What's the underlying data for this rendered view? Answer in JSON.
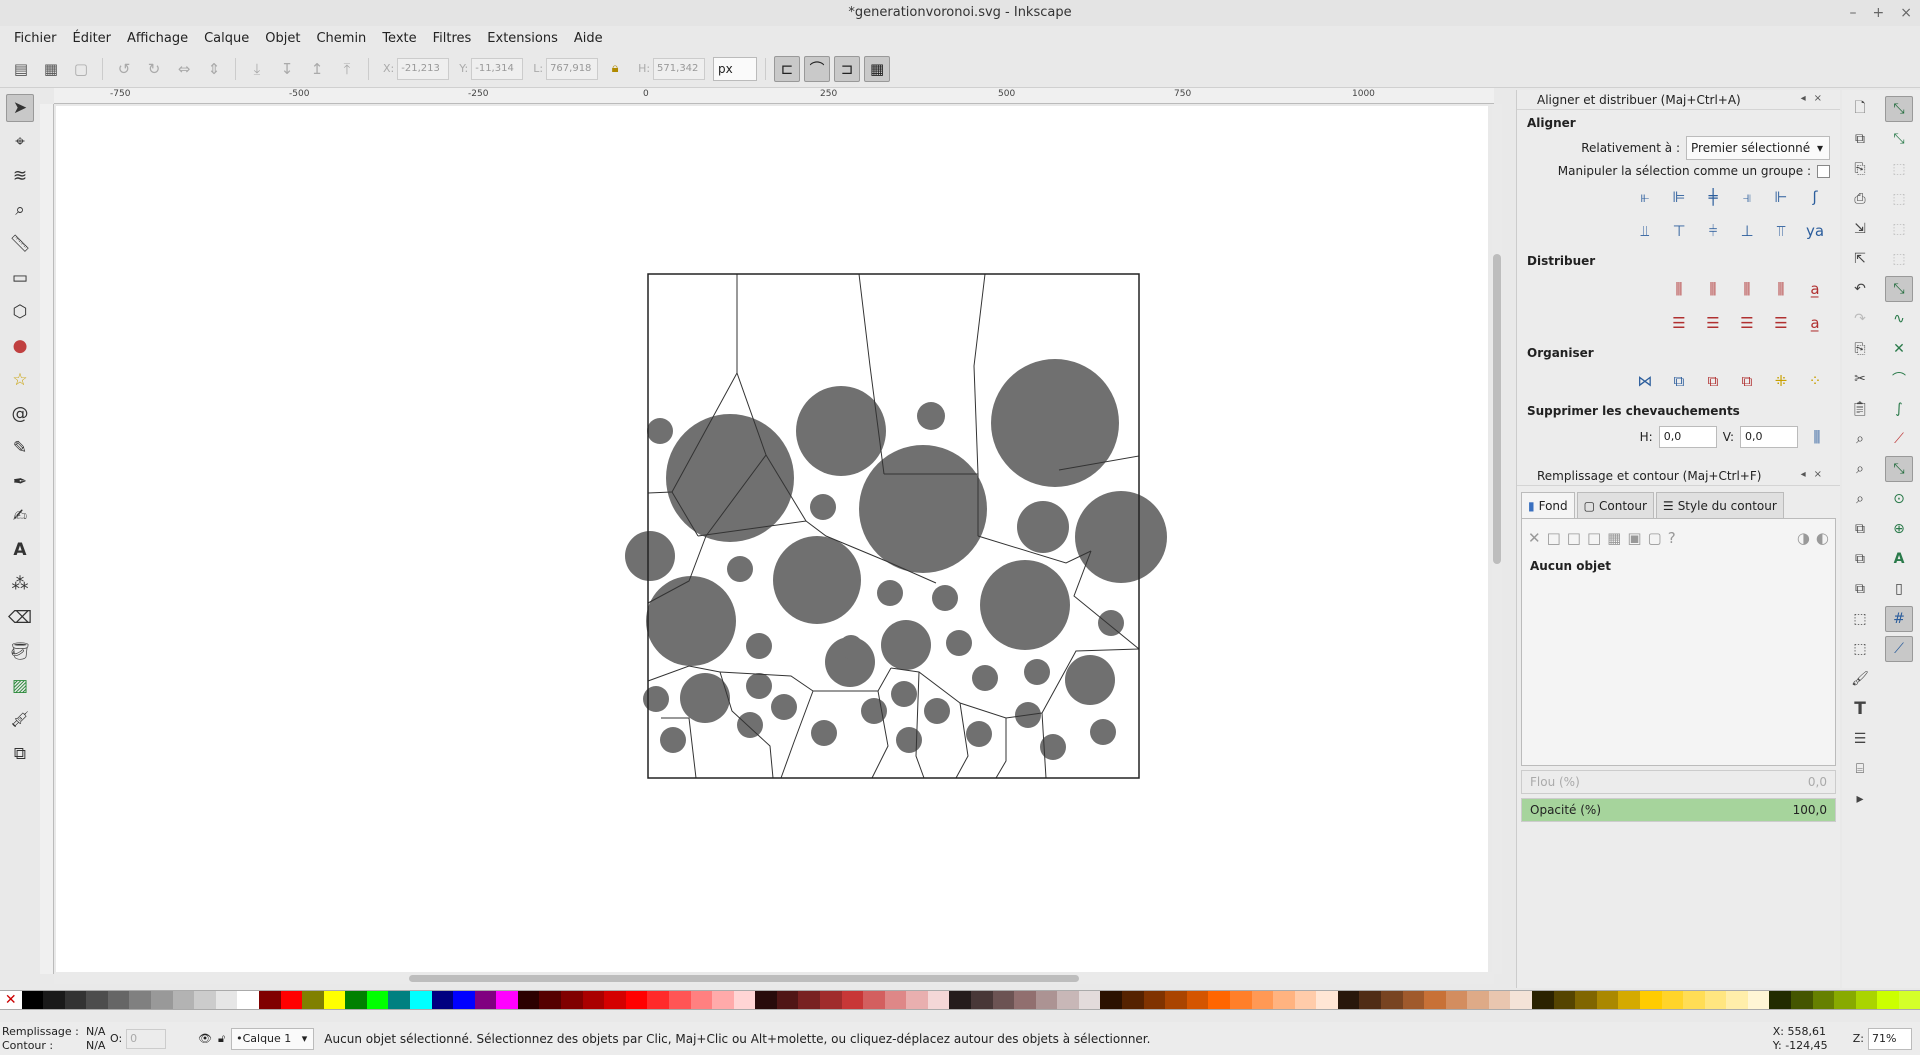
{
  "window": {
    "title": "*generationvoronoi.svg - Inkscape"
  },
  "menu": [
    "Fichier",
    "Éditer",
    "Affichage",
    "Calque",
    "Objet",
    "Chemin",
    "Texte",
    "Filtres",
    "Extensions",
    "Aide"
  ],
  "toolbar": {
    "x_label": "X:",
    "x_value": "-21,213",
    "y_label": "Y:",
    "y_value": "-11,314",
    "w_label": "L:",
    "w_value": "767,918",
    "h_label": "H:",
    "h_value": "571,342",
    "unit": "px"
  },
  "ruler": {
    "ticks": [
      "-750",
      "-500",
      "-250",
      "0",
      "250",
      "500",
      "750",
      "1000"
    ]
  },
  "align_panel": {
    "title": "Aligner et distribuer (Maj+Ctrl+A)",
    "align_heading": "Aligner",
    "relative_label": "Relativement à :",
    "relative_value": "Premier sélectionné",
    "group_label": "Manipuler la sélection comme un groupe :",
    "distribute_heading": "Distribuer",
    "organize_heading": "Organiser",
    "overlap_heading": "Supprimer les chevauchements",
    "h_label": "H:",
    "h_value": "0,0",
    "v_label": "V:",
    "v_value": "0,0"
  },
  "fill_panel": {
    "title": "Remplissage et contour (Maj+Ctrl+F)",
    "tabs": [
      "Fond",
      "Contour",
      "Style du contour"
    ],
    "no_object": "Aucun objet",
    "blur_label": "Flou (%)",
    "blur_value": "0,0",
    "opacity_label": "Opacité (%)",
    "opacity_value": "100,0"
  },
  "status": {
    "fill_label": "Remplissage :",
    "fill_value": "N/A",
    "stroke_label": "Contour :",
    "stroke_value": "N/A",
    "opacity_label": "O:",
    "opacity_value": "0",
    "layer": "•Calque 1",
    "message": "Aucun objet sélectionné. Sélectionnez des objets par Clic, Maj+Clic ou Alt+molette, ou cliquez-déplacez autour des objets à sélectionner.",
    "x_coord": "X: 558,61",
    "y_coord": "Y: -124,45",
    "zoom_label": "Z:",
    "zoom_value": "71%"
  },
  "colors": {
    "cell_fill": "#707070",
    "accent_green": "#a6d49c",
    "palette": [
      "#000000",
      "#1a1a1a",
      "#333333",
      "#4d4d4d",
      "#666666",
      "#808080",
      "#999999",
      "#b3b3b3",
      "#cccccc",
      "#e6e6e6",
      "#ffffff",
      "#800000",
      "#ff0000",
      "#808000",
      "#ffff00",
      "#008000",
      "#00ff00",
      "#008080",
      "#00ffff",
      "#000080",
      "#0000ff",
      "#800080",
      "#ff00ff",
      "#2b0000",
      "#550000",
      "#800000",
      "#aa0000",
      "#d40000",
      "#ff0000",
      "#ff2a2a",
      "#ff5555",
      "#ff8080",
      "#ffaaaa",
      "#ffd5d5",
      "#280b0b",
      "#501616",
      "#782121",
      "#a02c2c",
      "#c83737",
      "#d35f5f",
      "#de8787",
      "#e9afaf",
      "#f4d7d7",
      "#241c1c",
      "#483737",
      "#6c5353",
      "#916f6f",
      "#ac9393",
      "#c8b7b7",
      "#e3dbdb",
      "#2b1100",
      "#552200",
      "#803300",
      "#aa4400",
      "#d45500",
      "#ff6600",
      "#ff7f2a",
      "#ff9955",
      "#ffb380",
      "#ffccaa",
      "#ffe6d5",
      "#28170b",
      "#502d16",
      "#784421",
      "#a05a2c",
      "#c87137",
      "#d38d5f",
      "#deaa87",
      "#e9c6af",
      "#f4e3d7",
      "#2b2200",
      "#554400",
      "#806600",
      "#aa8800",
      "#d4aa00",
      "#ffcc00",
      "#ffd42a",
      "#ffdd55",
      "#ffe680",
      "#ffeeaa",
      "#fff6d5",
      "#222b00",
      "#445500",
      "#668000",
      "#88aa00",
      "#aad400",
      "#ccff00",
      "#d4ff2a"
    ]
  }
}
